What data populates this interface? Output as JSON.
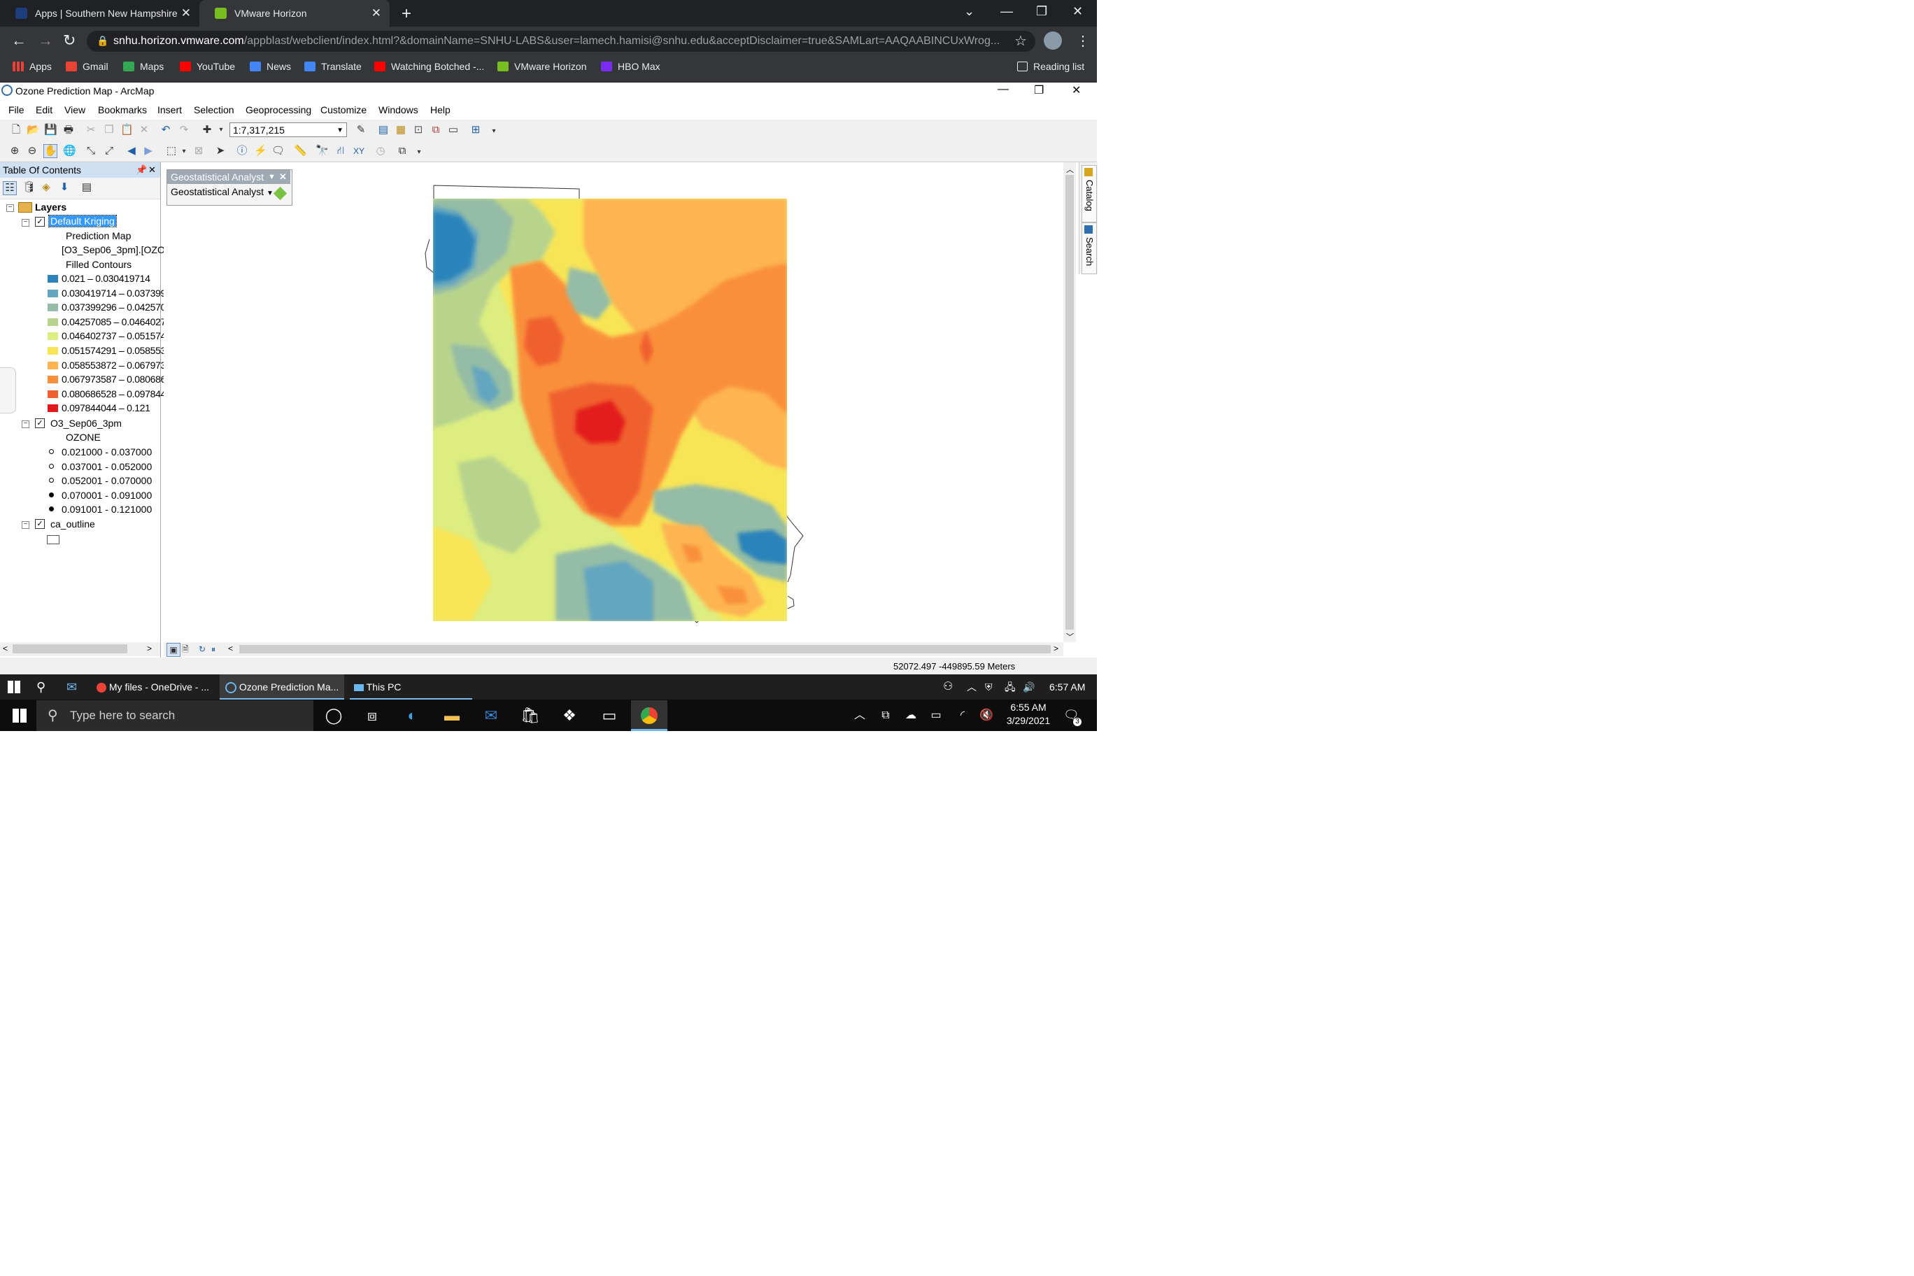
{
  "browser": {
    "tabs": [
      {
        "title": "Apps | Southern New Hampshire",
        "active": false
      },
      {
        "title": "VMware Horizon",
        "active": true
      }
    ],
    "url_host": "snhu.horizon.vmware.com",
    "url_rest": "/appblast/webclient/index.html?&domainName=SNHU-LABS&user=lamech.hamisi@snhu.edu&acceptDisclaimer=true&SAMLart=AAQAABINCUxWrog...",
    "bookmarks": [
      "Apps",
      "Gmail",
      "Maps",
      "YouTube",
      "News",
      "Translate",
      "Watching Botched -...",
      "VMware Horizon",
      "HBO Max"
    ],
    "reading_list": "Reading list"
  },
  "arcmap": {
    "title": "Ozone Prediction Map - ArcMap",
    "menus": [
      "File",
      "Edit",
      "View",
      "Bookmarks",
      "Insert",
      "Selection",
      "Geoprocessing",
      "Customize",
      "Windows",
      "Help"
    ],
    "scale": "1:7,317,215",
    "toc_title": "Table Of Contents",
    "toc": {
      "root": "Layers",
      "layer1": "Default Kriging",
      "layer1_sub1": "Prediction Map",
      "layer1_sub2": "[O3_Sep06_3pm].[OZO",
      "layer1_sub3": "Filled Contours",
      "contours": [
        {
          "label": "0.021 – 0.030419714",
          "color": "#2b83ba"
        },
        {
          "label": "0.030419714 – 0.037399",
          "color": "#64a6c0"
        },
        {
          "label": "0.037399296 – 0.042570",
          "color": "#94bca6"
        },
        {
          "label": "0.04257085 – 0.0464027",
          "color": "#b8d48c"
        },
        {
          "label": "0.046402737 – 0.051574",
          "color": "#dded80"
        },
        {
          "label": "0.051574291 – 0.058553",
          "color": "#f8e556"
        },
        {
          "label": "0.058553872 – 0.067973",
          "color": "#fdb451"
        },
        {
          "label": "0.067973587 – 0.080686",
          "color": "#f98f3b"
        },
        {
          "label": "0.080686528 – 0.097844",
          "color": "#f0612e"
        },
        {
          "label": "0.097844044 – 0.121",
          "color": "#e31a1c"
        }
      ],
      "layer2": "O3_Sep06_3pm",
      "layer2_field": "OZONE",
      "points": [
        "0.021000 - 0.037000",
        "0.037001 - 0.052000",
        "0.052001 - 0.070000",
        "0.070001 - 0.091000",
        "0.091001 - 0.121000"
      ],
      "layer3": "ca_outline"
    },
    "ga_window_title": "Geostatistical Analyst",
    "ga_button": "Geostatistical Analyst",
    "side_tabs": [
      "Catalog",
      "Search"
    ],
    "coords": "52072.497  -449895.59 Meters"
  },
  "remote_taskbar": {
    "items": [
      "My files - OneDrive - ...",
      "Ozone Prediction Ma...",
      "This PC"
    ],
    "time": "6:57 AM"
  },
  "local_taskbar": {
    "search_placeholder": "Type here to search",
    "time": "6:55 AM",
    "date": "3/29/2021",
    "notifications": "3"
  }
}
